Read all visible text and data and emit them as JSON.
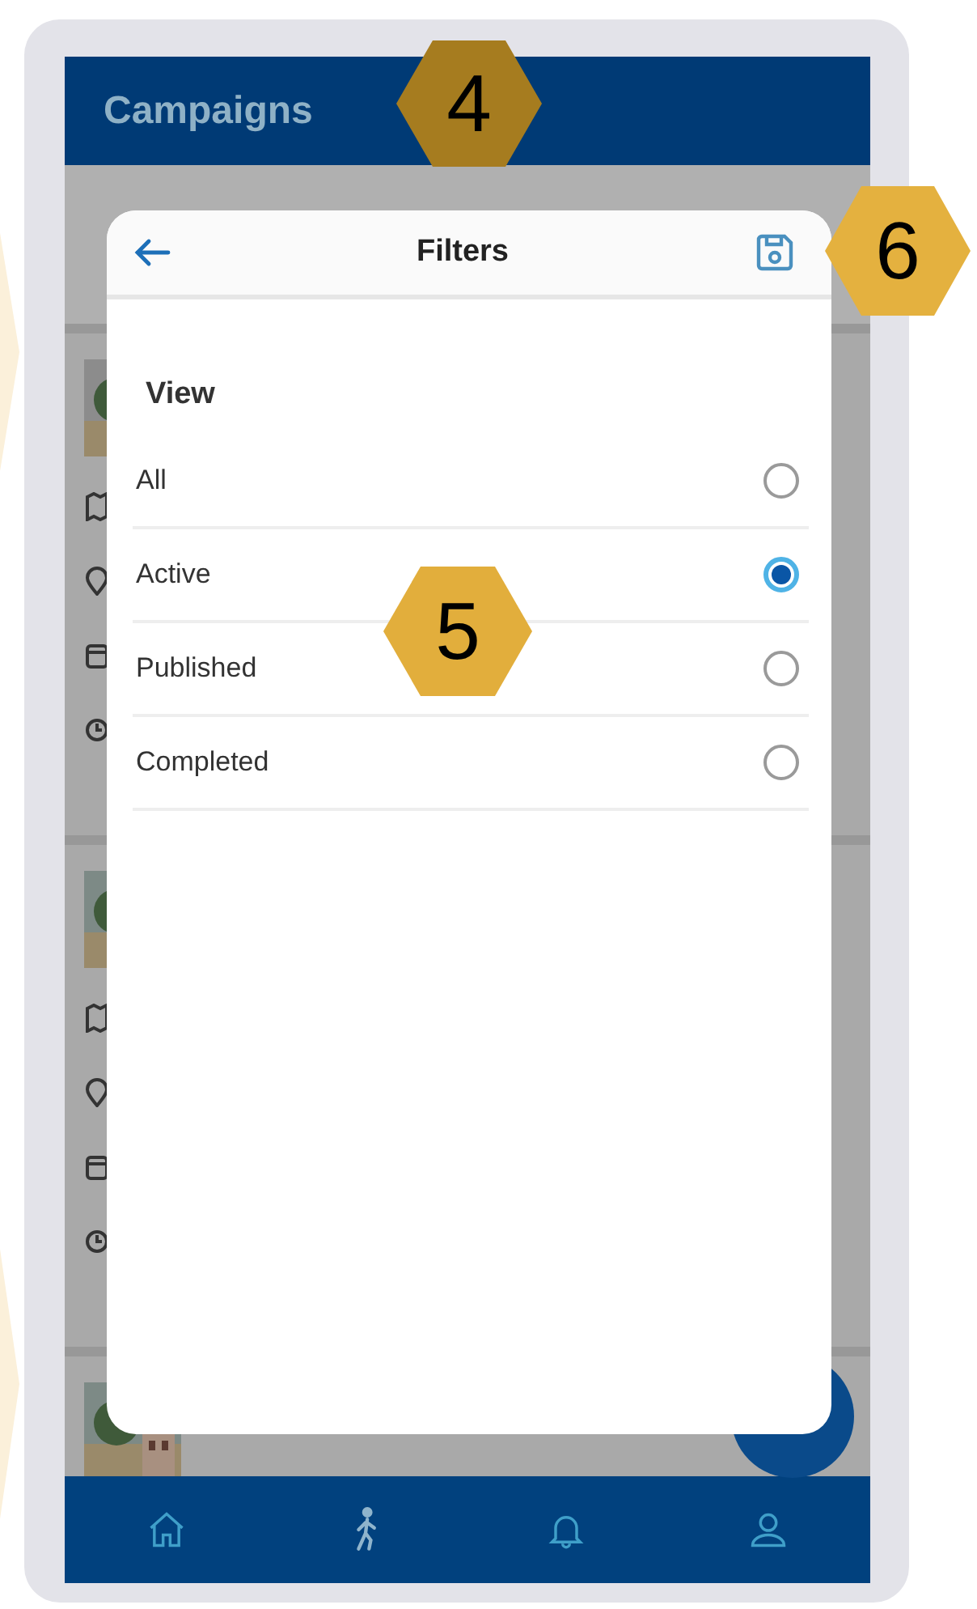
{
  "header": {
    "title": "Campaigns"
  },
  "filters": {
    "title": "Filters",
    "section": "View",
    "options": [
      {
        "label": "All",
        "selected": false
      },
      {
        "label": "Active",
        "selected": true
      },
      {
        "label": "Published",
        "selected": false
      },
      {
        "label": "Completed",
        "selected": false
      }
    ]
  },
  "nav": [
    {
      "kind": "home"
    },
    {
      "kind": "walk"
    },
    {
      "kind": "bell"
    },
    {
      "kind": "user"
    }
  ],
  "callouts": [
    {
      "label": "4",
      "color": "#a67c1f"
    },
    {
      "label": "5",
      "color": "#e2ae3c"
    },
    {
      "label": "6",
      "color": "#e4b13f"
    }
  ]
}
